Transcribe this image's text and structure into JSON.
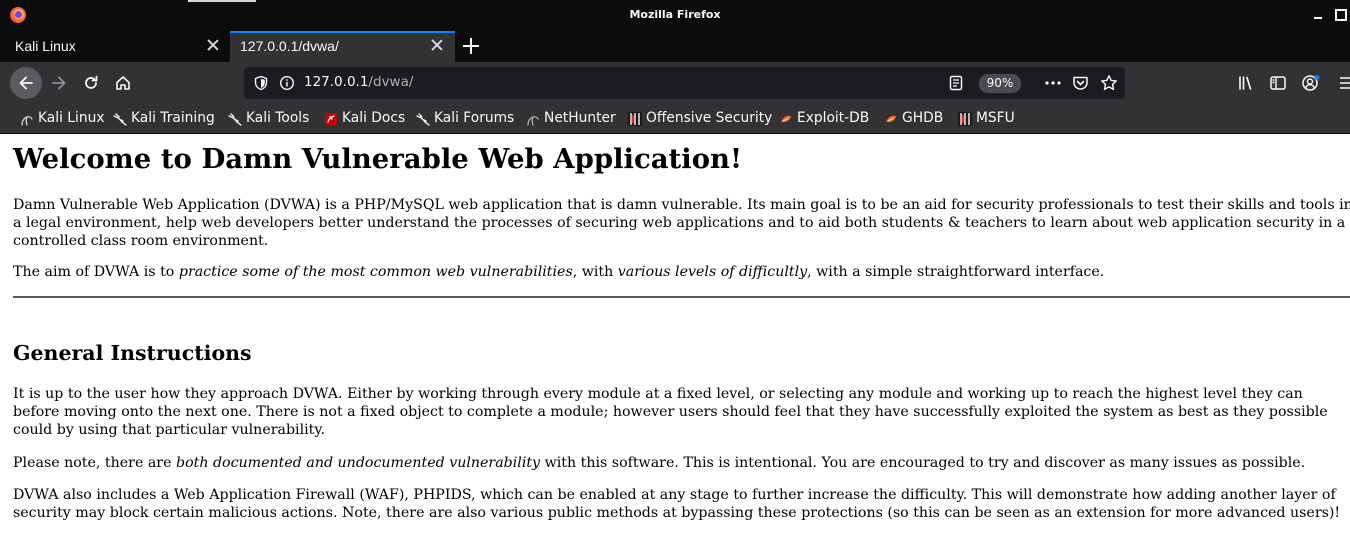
{
  "window": {
    "title": "Mozilla Firefox"
  },
  "tabs": [
    {
      "label": "Kali Linux"
    },
    {
      "label": "127.0.0.1/dvwa/"
    }
  ],
  "urlbar": {
    "host": "127.0.0.1",
    "path": "/dvwa/",
    "zoom": "90%"
  },
  "bookmarks": [
    {
      "label": "Kali Linux",
      "icon": "kali-dragon-icon"
    },
    {
      "label": "Kali Training",
      "icon": "kali-dragon-icon"
    },
    {
      "label": "Kali Tools",
      "icon": "kali-dragon-icon"
    },
    {
      "label": "Kali Docs",
      "icon": "kali-docs-icon"
    },
    {
      "label": "Kali Forums",
      "icon": "kali-dragon-icon"
    },
    {
      "label": "NetHunter",
      "icon": "nethunter-icon"
    },
    {
      "label": "Offensive Security",
      "icon": "offsec-icon"
    },
    {
      "label": "Exploit-DB",
      "icon": "exploit-db-icon"
    },
    {
      "label": "GHDB",
      "icon": "ghdb-icon"
    },
    {
      "label": "MSFU",
      "icon": "offsec-icon"
    }
  ],
  "page": {
    "heading": "Welcome to Damn Vulnerable Web Application!",
    "intro": "Damn Vulnerable Web Application (DVWA) is a PHP/MySQL web application that is damn vulnerable. Its main goal is to be an aid for security professionals to test their skills and tools in a legal environment, help web developers better understand the processes of securing web applications and to aid both students & teachers to learn about web application security in a controlled class room environment.",
    "aim": {
      "prefix": "The aim of DVWA is to ",
      "em1": "practice some of the most common web vulnerabilities",
      "middle": ", with ",
      "em2": "various levels of difficultly",
      "suffix": ", with a simple straightforward interface."
    },
    "subheading": "General Instructions",
    "instructions": "It is up to the user how they approach DVWA. Either by working through every module at a fixed level, or selecting any module and working up to reach the highest level they can before moving onto the next one. There is not a fixed object to complete a module; however users should feel that they have successfully exploited the system as best as they possible could by using that particular vulnerability.",
    "note": {
      "prefix": "Please note, there are ",
      "em": "both documented and undocumented vulnerability",
      "suffix": " with this software. This is intentional. You are encouraged to try and discover as many issues as possible."
    },
    "waf": "DVWA also includes a Web Application Firewall (WAF), PHPIDS, which can be enabled at any stage to further increase the difficulty. This will demonstrate how adding another layer of security may block certain malicious actions. Note, there are also various public methods at bypassing these protections (so this can be seen as an extension for more advanced users)!"
  },
  "colors": {
    "chrome_dark": "#0c0c0d",
    "toolbar": "#323234",
    "urlbar_bg": "#1c1b22",
    "active_tab_accent": "#0a84ff"
  }
}
